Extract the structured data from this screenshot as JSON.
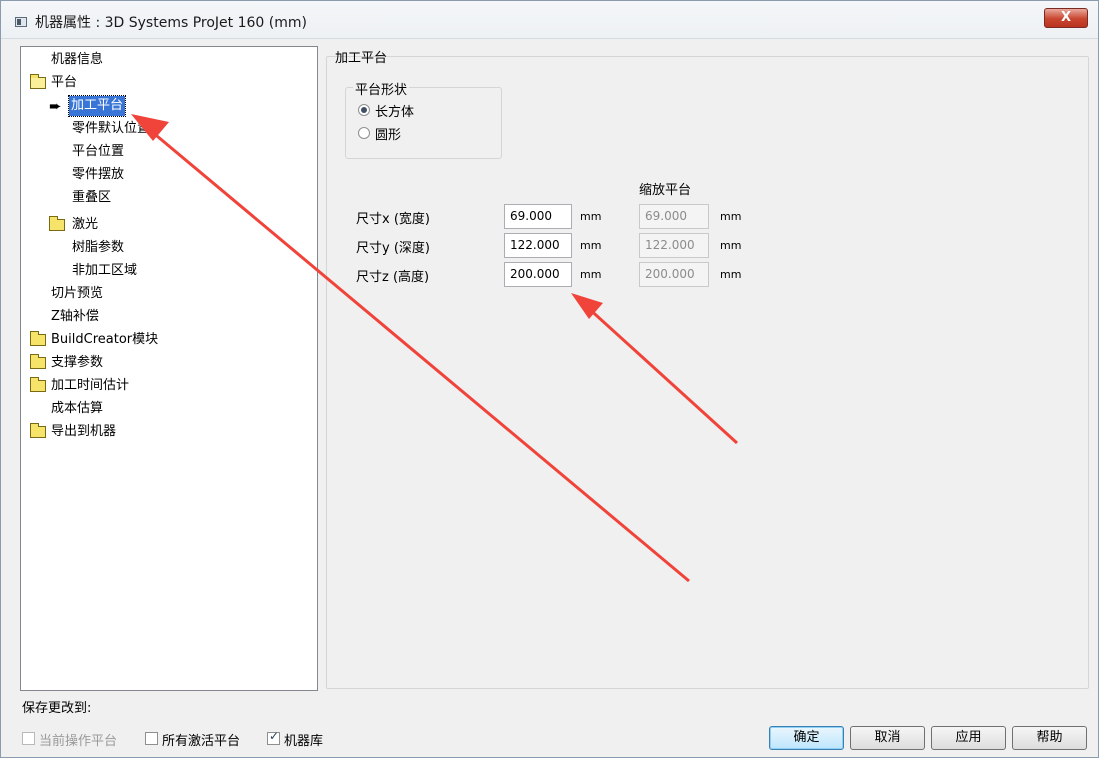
{
  "window": {
    "title": "机器属性 : 3D Systems ProJet 160 (mm)",
    "close_label": "X"
  },
  "tree": {
    "items": [
      {
        "label": "机器信息"
      },
      {
        "label": "平台"
      },
      {
        "label": "加工平台"
      },
      {
        "label": "零件默认位置"
      },
      {
        "label": "平台位置"
      },
      {
        "label": "零件摆放"
      },
      {
        "label": "重叠区"
      },
      {
        "label": "激光"
      },
      {
        "label": "树脂参数"
      },
      {
        "label": "非加工区域"
      },
      {
        "label": "切片预览"
      },
      {
        "label": "Z轴补偿"
      },
      {
        "label": "BuildCreator模块"
      },
      {
        "label": "支撑参数"
      },
      {
        "label": "加工时间估计"
      },
      {
        "label": "成本估算"
      },
      {
        "label": "导出到机器"
      }
    ]
  },
  "panel": {
    "title": "加工平台",
    "shape_group": {
      "title": "平台形状",
      "options": [
        {
          "label": "长方体",
          "checked": true
        },
        {
          "label": "圆形",
          "checked": false
        }
      ]
    },
    "scale_title": "缩放平台",
    "dimensions": [
      {
        "label": "尺寸x (宽度)",
        "value": "69.000",
        "unit": "mm",
        "scaled": "69.000",
        "scaled_unit": "mm"
      },
      {
        "label": "尺寸y (深度)",
        "value": "122.000",
        "unit": "mm",
        "scaled": "122.000",
        "scaled_unit": "mm"
      },
      {
        "label": "尺寸z (高度)",
        "value": "200.000",
        "unit": "mm",
        "scaled": "200.000",
        "scaled_unit": "mm"
      }
    ]
  },
  "footer": {
    "save_label": "保存更改到:",
    "checkboxes": [
      {
        "label": "当前操作平台",
        "checked": false,
        "disabled": true
      },
      {
        "label": "所有激活平台",
        "checked": false,
        "disabled": false
      },
      {
        "label": "机器库",
        "checked": true,
        "disabled": false
      }
    ],
    "buttons": {
      "ok": "确定",
      "cancel": "取消",
      "apply": "应用",
      "help": "帮助"
    }
  },
  "colors": {
    "selection": "#3875d7",
    "annotation_arrow": "#f0443a",
    "close_button": "#c9452f"
  }
}
